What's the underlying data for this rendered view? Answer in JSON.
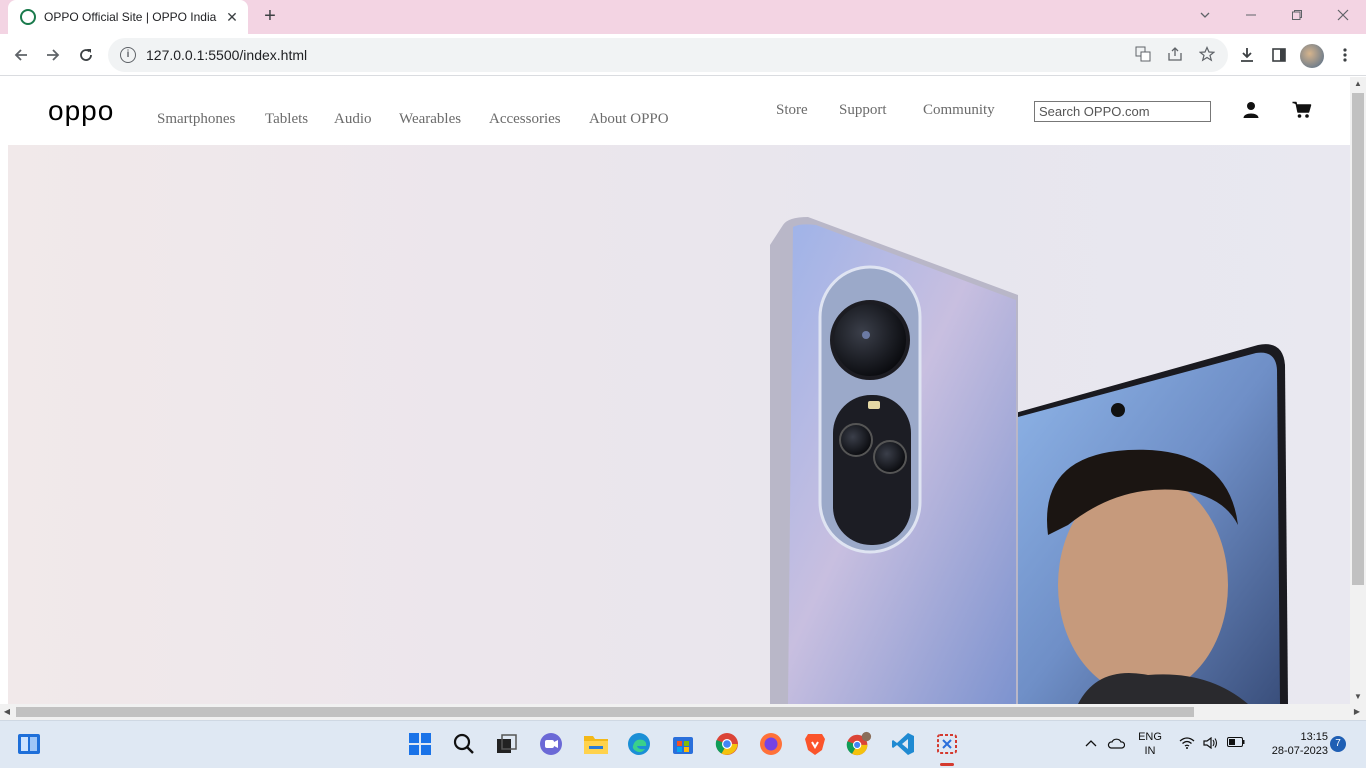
{
  "browser": {
    "tab_title": "OPPO Official Site | OPPO India",
    "tab_close": "✕",
    "new_tab": "+",
    "url": "127.0.0.1:5500/index.html"
  },
  "site": {
    "logo": "oppo",
    "nav_items": [
      "Smartphones",
      "Tablets",
      "Audio",
      "Wearables",
      "Accessories",
      "About OPPO"
    ],
    "right_nav": [
      "Store",
      "Support",
      "Community"
    ],
    "search_placeholder": "Search OPPO.com",
    "icons": [
      "user-icon",
      "cart-icon"
    ]
  },
  "taskbar": {
    "lang": "ENG",
    "region": "IN",
    "time": "13:15",
    "date": "28-07-2023",
    "notification_count": "7",
    "apps": [
      "windows-start-icon",
      "search-icon",
      "task-view-icon",
      "chat-icon",
      "file-explorer-icon",
      "edge-icon",
      "store-icon",
      "chrome-icon",
      "firefox-icon",
      "brave-icon",
      "chrome-profile-icon",
      "vscode-icon",
      "snipping-tool-icon"
    ]
  },
  "colors": {
    "tabstrip": "#f3d4e3",
    "nav_text": "#6b6b6b",
    "taskbar": "#dfe8f3"
  }
}
